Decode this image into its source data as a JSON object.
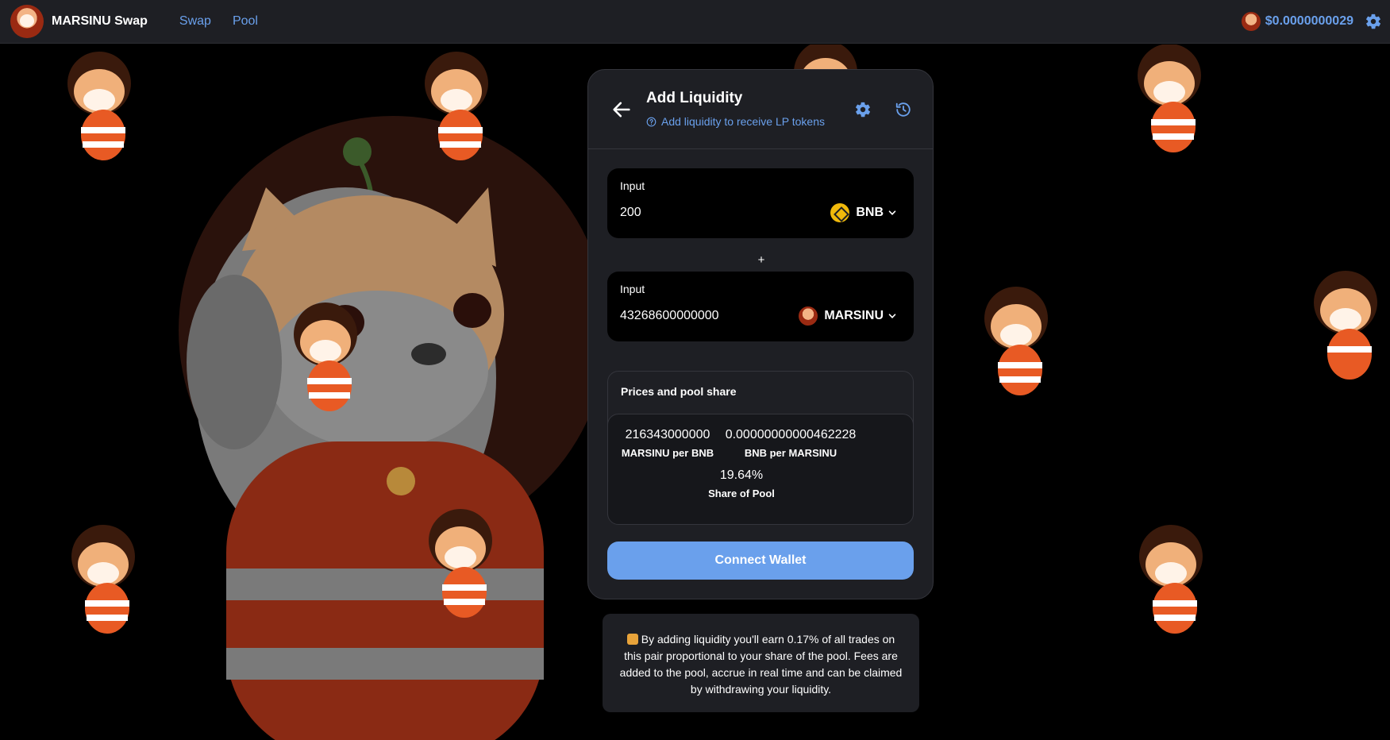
{
  "nav": {
    "brand": "MARSINU Swap",
    "links": [
      {
        "label": "Swap"
      },
      {
        "label": "Pool"
      }
    ],
    "token_price": "$0.0000000029"
  },
  "card": {
    "title": "Add Liquidity",
    "subtitle": "Add liquidity to receive LP tokens",
    "input_a": {
      "label": "Input",
      "value": "200",
      "token": "BNB"
    },
    "plus": "+",
    "input_b": {
      "label": "Input",
      "value": "43268600000000",
      "token": "MARSINU"
    },
    "pool": {
      "title": "Prices and pool share",
      "stats": [
        {
          "value": "216343000000",
          "label": "MARSINU per BNB"
        },
        {
          "value": "0.00000000000462228",
          "label": "BNB per MARSINU"
        },
        {
          "value": "19.64%",
          "label": "Share of Pool"
        }
      ]
    },
    "connect_button": "Connect Wallet"
  },
  "note": {
    "text": "By adding liquidity you'll earn 0.17% of all trades on this pair proportional to your share of the pool. Fees are added to the pool, accrue in real time and can be claimed by withdrawing your liquidity."
  },
  "colors": {
    "accent": "#6aa0ec",
    "panel": "#1e1f24",
    "background": "#000000",
    "bnb": "#f0b90b"
  },
  "icons": [
    "back-arrow-icon",
    "help-circle-icon",
    "gear-icon",
    "history-icon",
    "chevron-down-icon",
    "bnb-icon",
    "marsinu-icon"
  ]
}
